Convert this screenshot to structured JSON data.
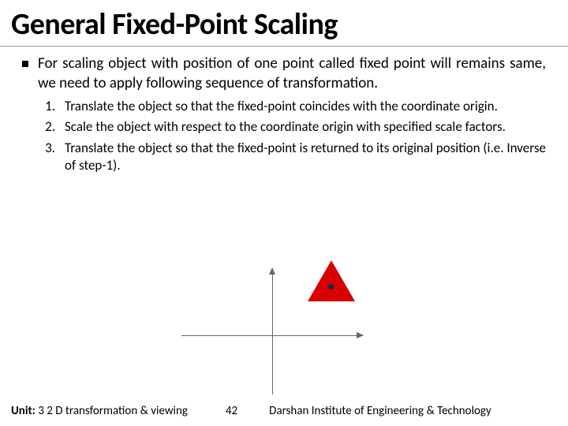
{
  "title": "General Fixed-Point Scaling",
  "bullet": "For scaling object with position of one point called fixed point will remains same, we need to apply following sequence of transformation.",
  "steps": {
    "n1": "1.",
    "t1": "Translate the object so that the fixed-point coincides with the coordinate origin.",
    "n2": "2.",
    "t2": "Scale the object with respect to the coordinate origin with specified scale factors.",
    "n3": "3.",
    "t3": "Translate the object so that the fixed-point is returned to its original position (i.e. Inverse of step-1)."
  },
  "footer": {
    "unit_label": "Unit:",
    "unit_value": "3 2 D transformation & viewing",
    "page": "42",
    "institute": "Darshan Institute of Engineering & Technology"
  }
}
